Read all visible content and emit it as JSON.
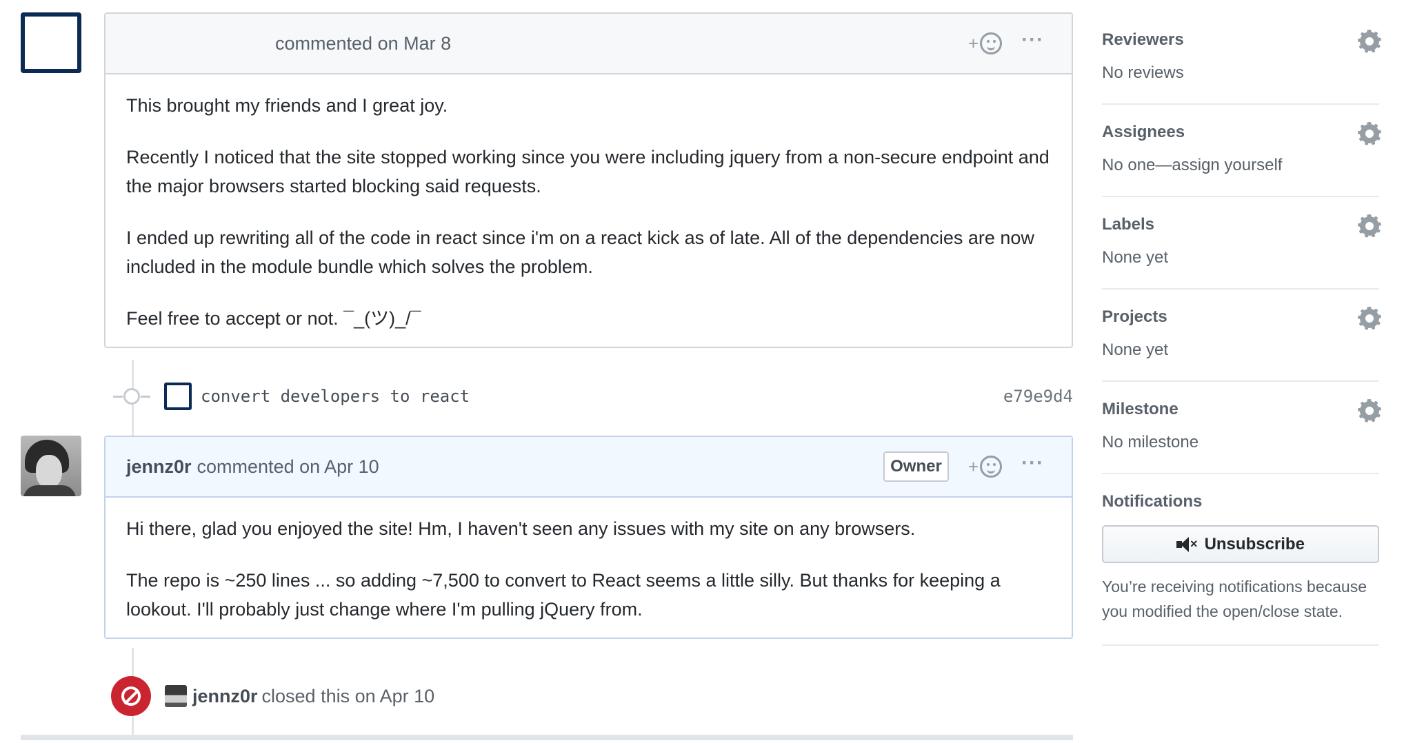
{
  "comment1": {
    "meta": "commented on Mar 8",
    "paragraphs": [
      "This brought my friends and I great joy.",
      "Recently I noticed that the site stopped working since you were including jquery from a non-secure endpoint and the major browsers started blocking said requests.",
      "I ended up rewriting all of the code in react since i'm on a react kick as of late. All of the dependencies are now included in the module bundle which solves the problem.",
      "Feel free to accept or not. ¯_(ツ)_/¯"
    ]
  },
  "commit": {
    "message": "convert developers to react",
    "sha": "e79e9d4"
  },
  "comment2": {
    "author": "jennz0r",
    "meta": "commented on Apr 10",
    "badge": "Owner",
    "paragraphs": [
      "Hi there, glad you enjoyed the site! Hm, I haven't seen any issues with my site on any browsers.",
      "The repo is ~250 lines ... so adding ~7,500 to convert to React seems a little silly. But thanks for keeping a lookout. I'll probably just change where I'm pulling jQuery from."
    ]
  },
  "closed_event": {
    "author": "jennz0r",
    "text": "closed this on Apr 10"
  },
  "reaction_plus": "+",
  "more_dots": "···",
  "sidebar": {
    "reviewers": {
      "heading": "Reviewers",
      "value": "No reviews"
    },
    "assignees": {
      "heading": "Assignees",
      "value": "No one—assign yourself"
    },
    "labels": {
      "heading": "Labels",
      "value": "None yet"
    },
    "projects": {
      "heading": "Projects",
      "value": "None yet"
    },
    "milestone": {
      "heading": "Milestone",
      "value": "No milestone"
    },
    "notifications": {
      "heading": "Notifications",
      "button_label": "Unsubscribe",
      "reason": "You’re receiving notifications because you modified the open/close state."
    }
  },
  "colors": {
    "closed_red": "#cb2431",
    "owner_header_bg": "#f1f8ff",
    "border": "#d1d5da"
  },
  "icons": [
    "smiley-reaction-icon",
    "more-options-icon",
    "gear-icon",
    "commit-node-icon",
    "closed-issue-icon",
    "mute-icon"
  ]
}
